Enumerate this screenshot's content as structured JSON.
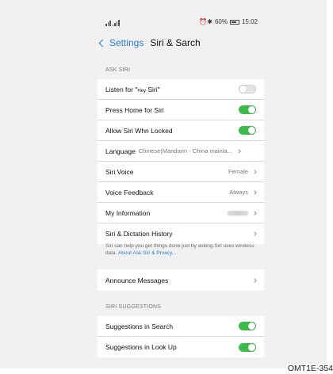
{
  "status_bar": {
    "battery": "60%",
    "time": "15:02"
  },
  "nav": {
    "back_label": "Settings",
    "title": "Siri & Sarch"
  },
  "ask_siri": {
    "header": "ASK SIRI",
    "rows": [
      {
        "label": "Listen for \"",
        "hey": "Hey",
        "label_tail": " Siri\"",
        "toggle": "off"
      },
      {
        "label": "Press Home for Siri",
        "toggle": "on"
      },
      {
        "label": "Allow Siri Whn Locked",
        "toggle": "on"
      },
      {
        "label": "Language",
        "sub": "Chinese(Mandarin - China mainla..."
      },
      {
        "label": "Siri Voice",
        "value": "Female"
      },
      {
        "label": "Voice Feedback",
        "value": "Always"
      },
      {
        "label": "My Information"
      },
      {
        "label": "Siri & Dictation History"
      }
    ],
    "footnote": "Siri can help you get things done just by asking.Siri uses wireless data.",
    "footnote_link": "About Ask Siri & Prvacy..."
  },
  "announce": {
    "label": "Announce Messages"
  },
  "suggestions": {
    "header": "SIRI SUGGESTIONS",
    "rows": [
      {
        "label": "Suggestions in Search",
        "toggle": "on"
      },
      {
        "label": "Suggestions in Look Up",
        "toggle": "on"
      }
    ]
  },
  "figure_code": "OMT1E-354",
  "colors": {
    "accent": "#2b7cd3",
    "toggle_on": "#3dbb4a",
    "background": "#f1f1f2"
  }
}
